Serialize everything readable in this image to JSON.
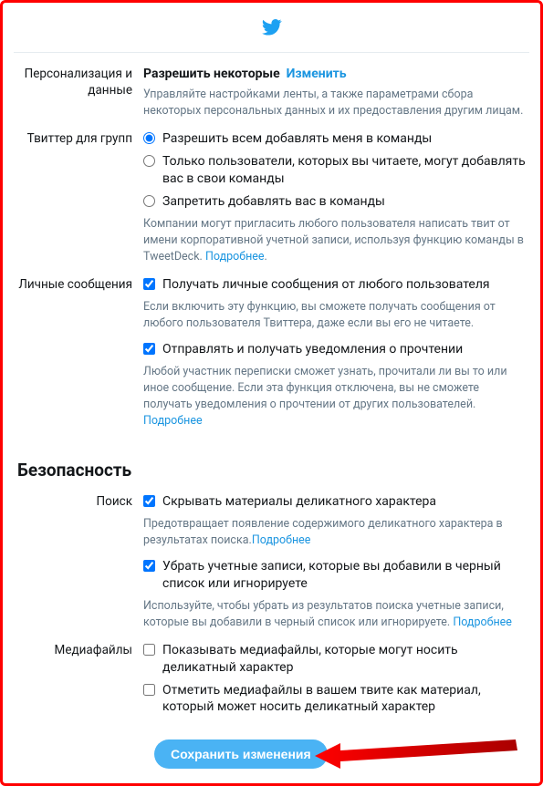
{
  "header": {
    "logo": "twitter-bird"
  },
  "personalization": {
    "label": "Персонализация и данные",
    "status": "Разрешить некоторые",
    "change": "Изменить",
    "desc": "Управляйте настройками ленты, а также параметрами сбора некоторых персональных данных и их предоставления другим лицам."
  },
  "teams": {
    "label": "Твиттер для групп",
    "options": [
      "Разрешить всем добавлять меня в команды",
      "Только пользователи, которых вы читаете, могут добавлять вас в свои команды",
      "Запретить добавлять вас в команды"
    ],
    "desc": "Компании могут пригласить любого пользователя написать твит от имени корпоративной учетной записи, используя функцию команды в TweetDeck. ",
    "more": "Подробнее"
  },
  "dm": {
    "label": "Личные сообщения",
    "opt1": "Получать личные сообщения от любого пользователя",
    "desc1": "Если включить эту функцию, вы сможете получать сообщения от любого пользователя Твиттера, даже если вы его не читаете.",
    "opt2": "Отправлять и получать уведомления о прочтении",
    "desc2": "Любой участник переписки сможет узнать, прочитали ли вы то или иное сообщение. Если эта функция отключена, вы не сможете получать уведомления о прочтении от других пользователей. ",
    "more": "Подробнее"
  },
  "security": {
    "heading": "Безопасность",
    "search": {
      "label": "Поиск",
      "opt1": "Скрывать материалы деликатного характера",
      "desc1": "Предотвращает появление содержимого деликатного характера в результатах поиска.",
      "more1": "Подробнее",
      "opt2": "Убрать учетные записи, которые вы добавили в черный список или игнорируете",
      "desc2": "Используйте, чтобы убрать из результатов поиска учетные записи, которые вы добавили в черный список или игнорируете. ",
      "more2": "Подробнее"
    },
    "media": {
      "label": "Медиафайлы",
      "opt1": "Показывать медиафайлы, которые могут носить деликатный характер",
      "opt2": "Отметить медиафайлы в вашем твите как материал, который может носить деликатный характер"
    }
  },
  "save": {
    "label": "Сохранить изменения"
  }
}
